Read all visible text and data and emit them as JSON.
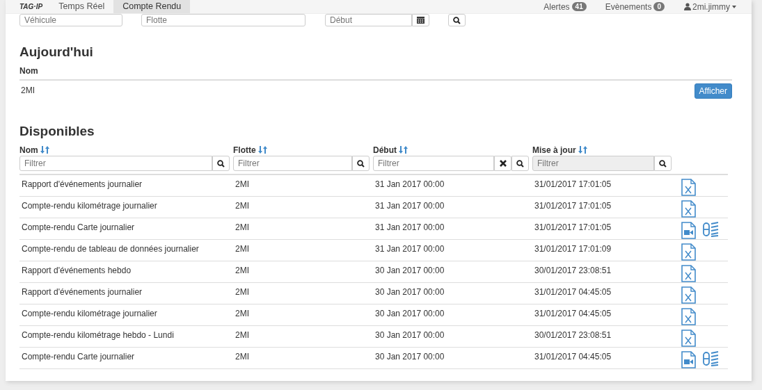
{
  "navbar": {
    "logo": "TAG·IP",
    "tabs": [
      {
        "label": "Temps Réel",
        "selected": false
      },
      {
        "label": "Compte Rendu",
        "selected": true
      }
    ],
    "alerts": {
      "label": "Alertes",
      "count": "41"
    },
    "events": {
      "label": "Evènements",
      "count": "0"
    },
    "user": "2mi.jimmy"
  },
  "search": {
    "vehicle_placeholder": "Véhicule",
    "fleet_placeholder": "Flotte",
    "start_placeholder": "Début"
  },
  "today": {
    "title": "Aujourd'hui",
    "column": "Nom",
    "rows": [
      {
        "name": "2MI",
        "button": "Afficher"
      }
    ]
  },
  "available": {
    "title": "Disponibles",
    "columns": [
      {
        "label": "Nom",
        "placeholder": "Filtrer",
        "clear": false,
        "disabled": false
      },
      {
        "label": "Flotte",
        "placeholder": "Filtrer",
        "clear": false,
        "disabled": false
      },
      {
        "label": "Début",
        "placeholder": "Filtrer",
        "clear": true,
        "disabled": false
      },
      {
        "label": "Mise à jour",
        "placeholder": "Filtrer",
        "clear": false,
        "disabled": true
      }
    ],
    "rows": [
      {
        "name": "Rapport d'événements journalier",
        "fleet": "2MI",
        "start": "31 Jan 2017 00:00",
        "updated": "31/01/2017 17:01:05",
        "kind": "excel"
      },
      {
        "name": "Compte-rendu kilométrage journalier",
        "fleet": "2MI",
        "start": "31 Jan 2017 00:00",
        "updated": "31/01/2017 17:01:05",
        "kind": "excel"
      },
      {
        "name": "Compte-rendu Carte journalier",
        "fleet": "2MI",
        "start": "31 Jan 2017 00:00",
        "updated": "31/01/2017 17:01:05",
        "kind": "map"
      },
      {
        "name": "Compte-rendu de tableau de données journalier",
        "fleet": "2MI",
        "start": "31 Jan 2017 00:00",
        "updated": "31/01/2017 17:01:09",
        "kind": "excel"
      },
      {
        "name": "Rapport d'événements hebdo",
        "fleet": "2MI",
        "start": "30 Jan 2017 00:00",
        "updated": "30/01/2017 23:08:51",
        "kind": "excel"
      },
      {
        "name": "Rapport d'événements journalier",
        "fleet": "2MI",
        "start": "30 Jan 2017 00:00",
        "updated": "31/01/2017 04:45:05",
        "kind": "excel"
      },
      {
        "name": "Compte-rendu kilométrage journalier",
        "fleet": "2MI",
        "start": "30 Jan 2017 00:00",
        "updated": "31/01/2017 04:45:05",
        "kind": "excel"
      },
      {
        "name": "Compte-rendu kilométrage hebdo - Lundi",
        "fleet": "2MI",
        "start": "30 Jan 2017 00:00",
        "updated": "30/01/2017 23:08:51",
        "kind": "excel"
      },
      {
        "name": "Compte-rendu Carte journalier",
        "fleet": "2MI",
        "start": "30 Jan 2017 00:00",
        "updated": "31/01/2017 04:45:05",
        "kind": "map"
      }
    ]
  }
}
